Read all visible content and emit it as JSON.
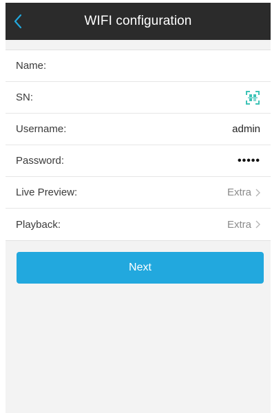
{
  "header": {
    "title": "WIFI configuration",
    "back_icon": "chevron-left-icon"
  },
  "form": {
    "name_label": "Name:",
    "name_value": "",
    "sn_label": "SN:",
    "sn_icon": "qr-scan-icon",
    "username_label": "Username:",
    "username_value": "admin",
    "password_label": "Password:",
    "password_value": "•••••",
    "live_preview_label": "Live Preview:",
    "live_preview_value": "Extra",
    "playback_label": "Playback:",
    "playback_value": "Extra"
  },
  "actions": {
    "next_label": "Next"
  },
  "colors": {
    "navbar_bg": "#2b2b2b",
    "accent": "#22a8de",
    "page_bg": "#f3f3f3",
    "scan_icon": "#3ec3b7"
  }
}
